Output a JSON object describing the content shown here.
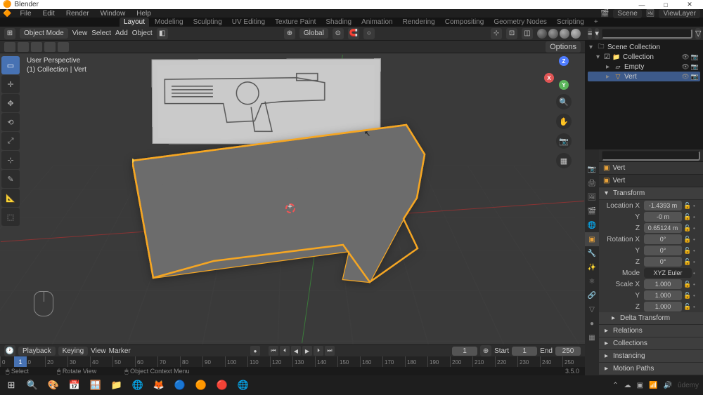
{
  "app": {
    "title": "Blender"
  },
  "window_controls": {
    "min": "—",
    "max": "□",
    "close": "✕"
  },
  "menu": {
    "items": [
      "File",
      "Edit",
      "Render",
      "Window",
      "Help"
    ]
  },
  "top_right": {
    "scene_label": "Scene",
    "viewlayer_label": "ViewLayer"
  },
  "workspaces": [
    "Layout",
    "Modeling",
    "Sculpting",
    "UV Editing",
    "Texture Paint",
    "Shading",
    "Animation",
    "Rendering",
    "Compositing",
    "Geometry Nodes",
    "Scripting"
  ],
  "active_workspace": "Layout",
  "viewport_header": {
    "mode": "Object Mode",
    "menus": [
      "View",
      "Select",
      "Add",
      "Object"
    ],
    "orientation": "Global",
    "options": "Options"
  },
  "viewport_info": {
    "line1": "User Perspective",
    "line2": "(1) Collection | Vert"
  },
  "nav_axes": {
    "x": "X",
    "y": "Y",
    "z": "Z"
  },
  "outliner": {
    "root": "Scene Collection",
    "collection": "Collection",
    "items": [
      {
        "name": "Empty"
      },
      {
        "name": "Vert"
      }
    ]
  },
  "properties": {
    "object_name": "Vert",
    "datablock": "Vert",
    "sections": {
      "transform": {
        "title": "Transform",
        "location": {
          "label": "Location X",
          "x": "-1.4393 m",
          "y": "-0 m",
          "z": "0.65124 m"
        },
        "rotation": {
          "label": "Rotation X",
          "x": "0°",
          "y": "0°",
          "z": "0°"
        },
        "mode": {
          "label": "Mode",
          "value": "XYZ Euler"
        },
        "scale": {
          "label": "Scale X",
          "x": "1.000",
          "y": "1.000",
          "z": "1.000"
        },
        "delta": "Delta Transform"
      },
      "relations": "Relations",
      "collections": "Collections",
      "instancing": "Instancing",
      "motion_paths": "Motion Paths"
    }
  },
  "timeline": {
    "menus": [
      "Playback",
      "Keying",
      "View",
      "Marker"
    ],
    "current": "1",
    "start_label": "Start",
    "start": "1",
    "end_label": "End",
    "end": "250",
    "marks": [
      "0",
      "10",
      "20",
      "30",
      "40",
      "50",
      "60",
      "70",
      "80",
      "90",
      "100",
      "110",
      "120",
      "130",
      "140",
      "150",
      "160",
      "170",
      "180",
      "190",
      "200",
      "210",
      "220",
      "230",
      "240",
      "250"
    ]
  },
  "statusbar": {
    "select": "Select",
    "rotate": "Rotate View",
    "context": "Object Context Menu",
    "version": "3.5.0"
  },
  "search_placeholder": "",
  "axis_labels": {
    "y": "Y",
    "z": "Z"
  }
}
